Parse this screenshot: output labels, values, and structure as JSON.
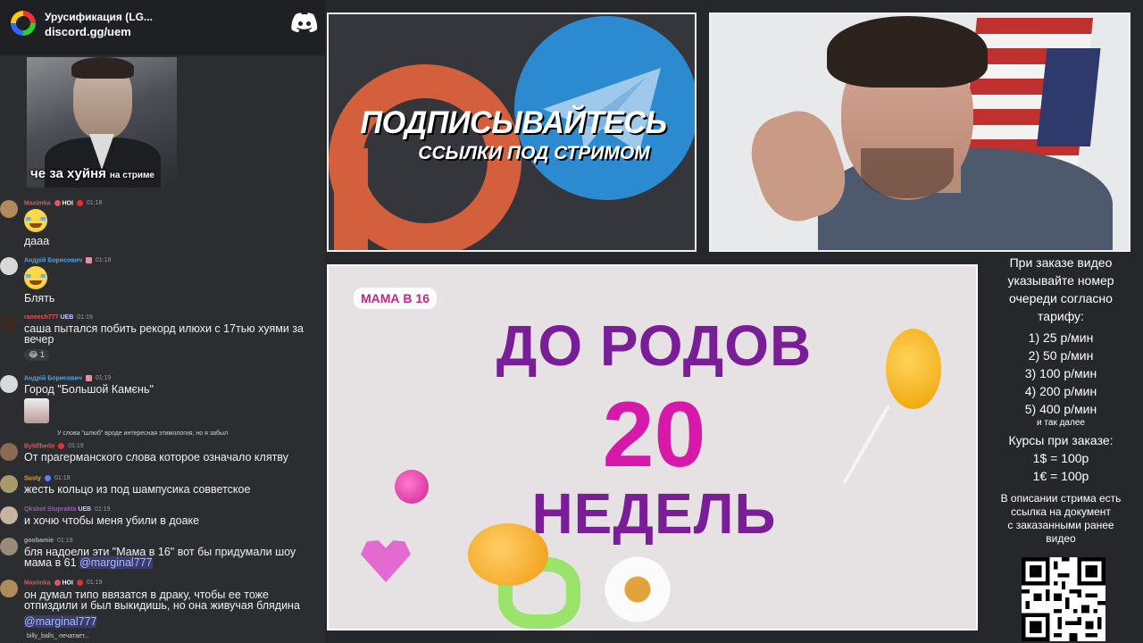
{
  "chat": {
    "server_name": "Урусификация (LG...",
    "server_link": "discord.gg/uem",
    "gif_caption_big": "че за хуйня",
    "gif_caption_small": "на стриме",
    "messages": [
      {
        "nick": "Maximka",
        "nick_color": "#e05555",
        "badges": "HOI",
        "time": "01:18",
        "text": "дааа"
      },
      {
        "nick": "Андрій Борисович",
        "nick_color": "#4fa3e0",
        "time": "01:18",
        "text": "Блять"
      },
      {
        "nick": "raneech777",
        "nick_color": "#e05555",
        "badges": "UEB",
        "time": "01:19",
        "text": "саша пытался побить рекорд илюхи с 17тью хуями за вечер",
        "reaction": "😂 1"
      },
      {
        "nick": "Андрій Борисович",
        "nick_color": "#4fa3e0",
        "time": "01:19",
        "text": "Город \"Большой Камєнь\""
      },
      {
        "reply": "У слова \"шлюб\" вроде интересная этимология, но я забыл"
      },
      {
        "nick": "Byldfbedo",
        "nick_color": "#e05555",
        "time": "01:19",
        "text": "От прагерманского слова которое означало клятву"
      },
      {
        "nick": "Susty",
        "nick_color": "#e0a030",
        "time": "01:19",
        "text": "жесть кольцо из под шампусика совветское"
      },
      {
        "nick": "Qksbot Stuprakta",
        "nick_color": "#9b59b6",
        "badges": "UEB",
        "time": "01:19",
        "text": "и хочю чтобы меня убили в доаке"
      },
      {
        "nick": "goobamie",
        "nick_color": "#aaaaaa",
        "time": "01:19",
        "text_line1": "бля надоели эти \"Мама в 16\" вот бы придумали шоу",
        "text_line2": "мама в 61",
        "mention": "@marginal777"
      },
      {
        "nick": "Maximka",
        "nick_color": "#e05555",
        "badges": "HOI",
        "time": "01:19",
        "text_line1": "он думал типо ввязатся в драку, чтобы ее тоже",
        "text_line2": "отпиздили и был выкидишь, но она живучая блядина",
        "mention": "@marginal777"
      }
    ],
    "typing": "billy_balls_ печатает..."
  },
  "promo": {
    "title": "ПОДПИСЫВАЙТЕСЬ",
    "subtitle": "ССЫЛКИ ПОД СТРИМОМ"
  },
  "video": {
    "badge": "МАМА В 16",
    "line1": "ДО РОДОВ",
    "number": "20",
    "line3": "НЕДЕЛЬ"
  },
  "info": {
    "intro": [
      "При заказе видео",
      "указывайте номер",
      "очереди согласно",
      "тарифу:"
    ],
    "tariffs": [
      "1) 25 р/мин",
      "2) 50 р/мин",
      "3) 100 р/мин",
      "4) 200 р/мин",
      "5) 400 р/мин"
    ],
    "etc": "и так далее",
    "courses_title": "Курсы при заказе:",
    "rates": [
      "1$ = 100р",
      "1€ = 100р"
    ],
    "outro": [
      "В описании стрима есть",
      "ссылка на документ",
      "с заказанными ранее",
      "видео"
    ]
  },
  "colors": {
    "discord_blurple": "#5865F2",
    "video_purple": "#7a1e98",
    "video_pink": "#d619a9"
  }
}
